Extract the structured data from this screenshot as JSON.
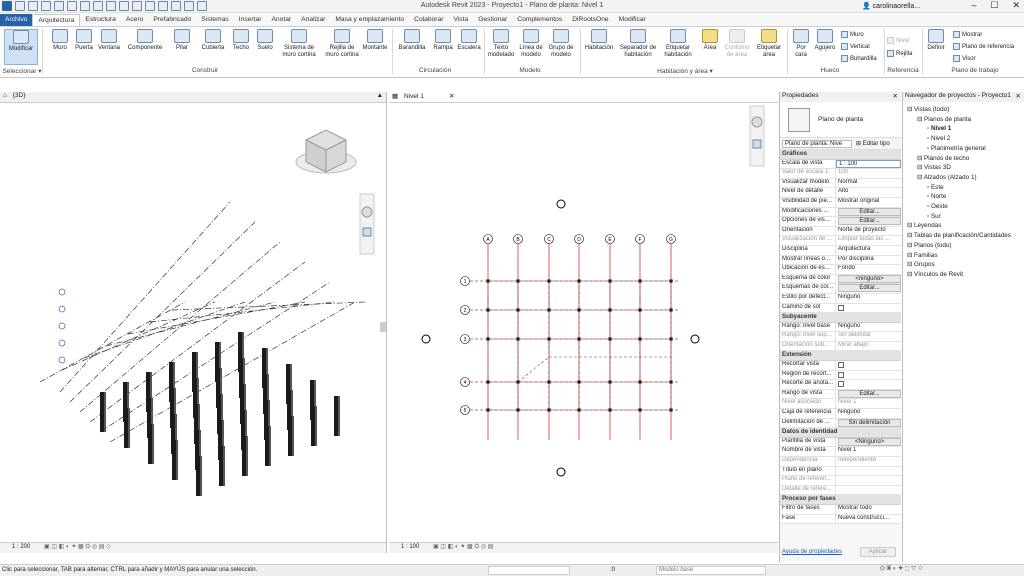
{
  "app": {
    "title": "Autodesk Revit 2023 - Proyecto1 - Plano de planta: Nivel 1",
    "user": "carolinaorella..."
  },
  "menu_tabs": [
    "Archivo",
    "Arquitectura",
    "Estructura",
    "Acero",
    "Prefabricado",
    "Sistemas",
    "Insertar",
    "Anotar",
    "Analizar",
    "Masa y emplazamiento",
    "Colaborar",
    "Vista",
    "Gestionar",
    "Complementos",
    "DiRootsOne",
    "Modificar"
  ],
  "ribbon": {
    "buttons": {
      "modificar": "Modificar",
      "muro": "Muro",
      "puerta": "Puerta",
      "ventana": "Ventana",
      "componente": "Componente",
      "pilar": "Pilar",
      "cubierta": "Cubierta",
      "techo": "Techo",
      "suelo": "Suelo",
      "sistema_muro_cortina": "Sistema de muro cortina",
      "rejilla_muro_cortina": "Rejilla de muro cortina",
      "montante": "Montante",
      "barandilla": "Barandilla",
      "rampa": "Rampa",
      "escalera": "Escalera",
      "texto_modelado": "Texto modelado",
      "linea_modelo": "Línea de modelo",
      "grupo_modelo": "Grupo de modelo",
      "habitacion": "Habitación",
      "separador_habitacion": "Separador de habitación",
      "etiquetar_habitacion": "Etiquetar habitación",
      "area": "Área",
      "contorno_area": "Contorno de área",
      "etiquetar_area": "Etiquetar área",
      "por_cara": "Por cara",
      "agujero": "Agujero",
      "muro_small": "Muro",
      "vertical": "Vertical",
      "buhardilla": "Buhardilla",
      "nivel": "Nivel",
      "rejilla": "Rejilla",
      "definir": "Definir",
      "mostrar": "Mostrar",
      "plano_referencia": "Plano de referencia",
      "visor": "Visor"
    },
    "panels": {
      "seleccionar": "Seleccionar",
      "construir": "Construir",
      "circulacion": "Circulación",
      "modelo": "Modelo",
      "habitacion_area": "Habitación y área",
      "hueco": "Hueco",
      "referencia": "Referencia",
      "plano_trabajo": "Plano de trabajo"
    }
  },
  "view3d": {
    "tab": "{3D}",
    "scale": "1 : 200"
  },
  "plan_view": {
    "tab": "Nivel 1",
    "scale": "1 : 100",
    "grid_letters": [
      "A",
      "B",
      "C",
      "D",
      "E",
      "F",
      "G"
    ],
    "grid_numbers": [
      "1",
      "2",
      "3",
      "4",
      "5"
    ]
  },
  "properties": {
    "title": "Propiedades",
    "type_name": "Plano de planta",
    "type_selector": "Plano de planta: Nive",
    "edit_type": "Editar tipo",
    "help_link": "Ayuda de propiedades",
    "apply": "Aplicar",
    "sections": [
      {
        "name": "Gráficos",
        "rows": [
          {
            "k": "Escala de vista",
            "v": "1 : 100",
            "kind": "input"
          },
          {
            "k": "Valor de escala    1:",
            "v": "100",
            "kind": "dis"
          },
          {
            "k": "Visualizar modelo",
            "v": "Normal"
          },
          {
            "k": "Nivel de detalle",
            "v": "Alto"
          },
          {
            "k": "Visibilidad de pie...",
            "v": "Mostrar original"
          },
          {
            "k": "Modificaciones ...",
            "v": "Editar...",
            "kind": "btn"
          },
          {
            "k": "Opciones de vis...",
            "v": "Editar...",
            "kind": "btn"
          },
          {
            "k": "Orientación",
            "v": "Norte de proyecto"
          },
          {
            "k": "Visualización de ...",
            "v": "Limpiar todas las ...",
            "kind": "dis"
          },
          {
            "k": "Disciplina",
            "v": "Arquitectura"
          },
          {
            "k": "Mostrar líneas o...",
            "v": "Por disciplina"
          },
          {
            "k": "Ubicación de es...",
            "v": "Fondo"
          },
          {
            "k": "Esquema de color",
            "v": "<ninguno>",
            "kind": "btn"
          },
          {
            "k": "Esquemas de col...",
            "v": "Editar...",
            "kind": "btn"
          },
          {
            "k": "Estilo por defect...",
            "v": "Ninguno"
          },
          {
            "k": "Camino de sol",
            "v": "",
            "kind": "cb"
          }
        ]
      },
      {
        "name": "Subyacente",
        "rows": [
          {
            "k": "Rango: nivel base",
            "v": "Ninguno"
          },
          {
            "k": "Rango: nivel sup...",
            "v": "Sin delimitar",
            "kind": "dis"
          },
          {
            "k": "Orientación sub...",
            "v": "Mirar abajo",
            "kind": "dis"
          }
        ]
      },
      {
        "name": "Extensión",
        "rows": [
          {
            "k": "Recortar vista",
            "v": "",
            "kind": "cb"
          },
          {
            "k": "Región de recort...",
            "v": "",
            "kind": "cb"
          },
          {
            "k": "Recorte de anota...",
            "v": "",
            "kind": "cb"
          },
          {
            "k": "Rango de vista",
            "v": "Editar...",
            "kind": "btn"
          },
          {
            "k": "Nivel asociado",
            "v": "Nivel 1",
            "kind": "dis"
          },
          {
            "k": "Caja de referencia",
            "v": "Ninguno"
          },
          {
            "k": "Delimitación de ...",
            "v": "Sin delimitación",
            "kind": "btn"
          }
        ]
      },
      {
        "name": "Datos de identidad",
        "rows": [
          {
            "k": "Plantilla de vista",
            "v": "<Ninguno>",
            "kind": "btn"
          },
          {
            "k": "Nombre de vista",
            "v": "Nivel 1"
          },
          {
            "k": "Dependencia",
            "v": "Independiente",
            "kind": "dis"
          },
          {
            "k": "Título en plano",
            "v": ""
          },
          {
            "k": "Plano de referen...",
            "v": "",
            "kind": "dis"
          },
          {
            "k": "Detalle de refere...",
            "v": "",
            "kind": "dis"
          }
        ]
      },
      {
        "name": "Proceso por fases",
        "rows": [
          {
            "k": "Filtro de fases",
            "v": "Mostrar todo"
          },
          {
            "k": "Fase",
            "v": "Nueva construcci..."
          }
        ]
      }
    ]
  },
  "browser": {
    "title": "Navegador de proyectos - Proyecto1",
    "tree": [
      {
        "t": "Vistas (todo)",
        "d": 0
      },
      {
        "t": "Planos de planta",
        "d": 1
      },
      {
        "t": "Nivel 1",
        "d": 2,
        "bold": true
      },
      {
        "t": "Nivel 2",
        "d": 2
      },
      {
        "t": "Planimetría general",
        "d": 2
      },
      {
        "t": "Planos de techo",
        "d": 1
      },
      {
        "t": "Vistas 3D",
        "d": 1
      },
      {
        "t": "Alzados (Alzado 1)",
        "d": 1
      },
      {
        "t": "Este",
        "d": 2
      },
      {
        "t": "Norte",
        "d": 2
      },
      {
        "t": "Oeste",
        "d": 2
      },
      {
        "t": "Sur",
        "d": 2
      },
      {
        "t": "Leyendas",
        "d": 0
      },
      {
        "t": "Tablas de planificación/Cantidades",
        "d": 0
      },
      {
        "t": "Planos (todo)",
        "d": 0
      },
      {
        "t": "Familias",
        "d": 0
      },
      {
        "t": "Grupos",
        "d": 0
      },
      {
        "t": "Vínculos de Revit",
        "d": 0
      }
    ]
  },
  "status": {
    "message": "Clic para seleccionar, TAB para alternar, CTRL para añadir y MAYÚS para anular una selección.",
    "zero": ":0",
    "model": "Modelo base"
  }
}
